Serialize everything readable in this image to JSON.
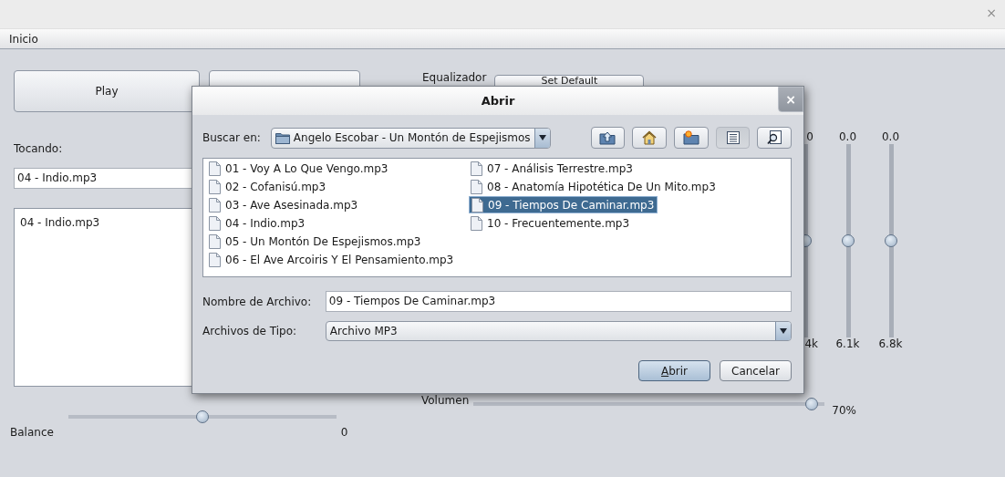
{
  "window": {
    "close": "×"
  },
  "menu": [
    {
      "label": "Inicio"
    }
  ],
  "play_button": "Play",
  "equalizer": {
    "label": "Equalizador",
    "reset_button": "Set Default",
    "bands": [
      {
        "value": "0",
        "level": 0.5,
        "freq": "4k"
      },
      {
        "value": "0.0",
        "level": 0.5,
        "freq": "6.1k"
      },
      {
        "value": "0.0",
        "level": 0.5,
        "freq": "6.8k"
      }
    ]
  },
  "now_playing": {
    "label": "Tocando:",
    "value": "04 - Indio.mp3"
  },
  "playlist": [
    {
      "title": "04 - Indio.mp3"
    }
  ],
  "volume": {
    "label": "Volumen",
    "level": 0.98,
    "reading": "70%"
  },
  "balance": {
    "label": "Balance",
    "level": 0.5,
    "reading": "0"
  },
  "dialog": {
    "title": "Abrir",
    "close": "×",
    "look_in": {
      "label": "Buscar en:",
      "value": "Angelo Escobar - Un Montón de Espejismos"
    },
    "toolbar": [
      {
        "kind": "up",
        "selected": false
      },
      {
        "kind": "home",
        "selected": false
      },
      {
        "kind": "new-folder",
        "selected": false
      },
      {
        "kind": "list",
        "selected": true
      },
      {
        "kind": "details",
        "selected": false
      }
    ],
    "files": [
      {
        "name": "01 - Voy A Lo Que Vengo.mp3",
        "selected": false
      },
      {
        "name": "02 - Cofanisú.mp3",
        "selected": false
      },
      {
        "name": "03 - Ave Asesinada.mp3",
        "selected": false
      },
      {
        "name": "04 - Indio.mp3",
        "selected": false
      },
      {
        "name": "05 - Un Montón De Espejismos.mp3",
        "selected": false
      },
      {
        "name": "06 - El Ave Arcoiris Y El Pensamiento.mp3",
        "selected": false
      },
      {
        "name": "07 - Análisis Terrestre.mp3",
        "selected": false
      },
      {
        "name": "08 - Anatomía Hipotética De Un Mito.mp3",
        "selected": false
      },
      {
        "name": "09 - Tiempos De Caminar.mp3",
        "selected": true
      },
      {
        "name": "10 - Frecuentemente.mp3",
        "selected": false
      }
    ],
    "file_name": {
      "label": "Nombre de Archivo:",
      "value": "09 - Tiempos De Caminar.mp3"
    },
    "file_type": {
      "label": "Archivos de Tipo:",
      "value": "Archivo MP3"
    },
    "buttons": [
      {
        "label": "Abrir",
        "default": true
      },
      {
        "label": "Cancelar",
        "default": false
      }
    ]
  }
}
